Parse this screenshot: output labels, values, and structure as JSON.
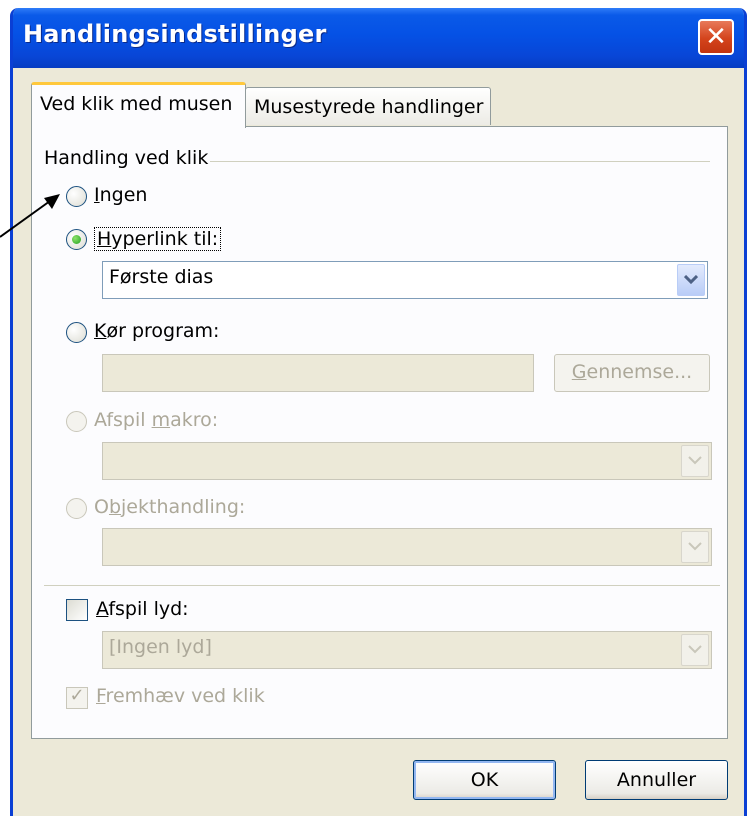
{
  "window": {
    "title": "Handlingsindstillinger",
    "close_glyph": "✕"
  },
  "tabs": [
    {
      "label": "Ved klik med musen",
      "active": true
    },
    {
      "label": "Musestyrede handlinger",
      "active": false
    }
  ],
  "group": {
    "title": "Handling ved klik"
  },
  "options": {
    "none": {
      "label": "Ingen",
      "accel": "I",
      "rest": "ngen",
      "selected": false
    },
    "hyperlink": {
      "label": "Hyperlink til:",
      "accel": "H",
      "rest": "yperlink til:",
      "selected": true,
      "value": "Første dias"
    },
    "run_program": {
      "label": "Kør program:",
      "accel": "K",
      "rest": "ør program:",
      "selected": false,
      "value": ""
    },
    "run_macro": {
      "label": "Afspil makro:",
      "pre": "Afspil ",
      "accel": "m",
      "rest": "akro:",
      "enabled": false
    },
    "object_action": {
      "label": "Objekthandling:",
      "pre": "O",
      "accel": "b",
      "rest": "jekthandling:",
      "enabled": false
    }
  },
  "browse_button": {
    "label": "Gennemse...",
    "accel": "G",
    "rest": "ennemse...",
    "enabled": false
  },
  "play_sound": {
    "label": "Afspil lyd:",
    "accel": "A",
    "rest": "fspil lyd:",
    "checked": false,
    "value": "[Ingen lyd]"
  },
  "highlight": {
    "label": "Fremhæv ved klik",
    "accel": "F",
    "rest": "remhæv ved klik",
    "checked": true,
    "enabled": false
  },
  "buttons": {
    "ok": "OK",
    "cancel": "Annuller"
  },
  "colors": {
    "titlebar": "#0551e5",
    "face": "#ece9d8",
    "panel": "#fcfcfe",
    "tab_highlight": "#ffc83c",
    "close": "#d4441c"
  }
}
